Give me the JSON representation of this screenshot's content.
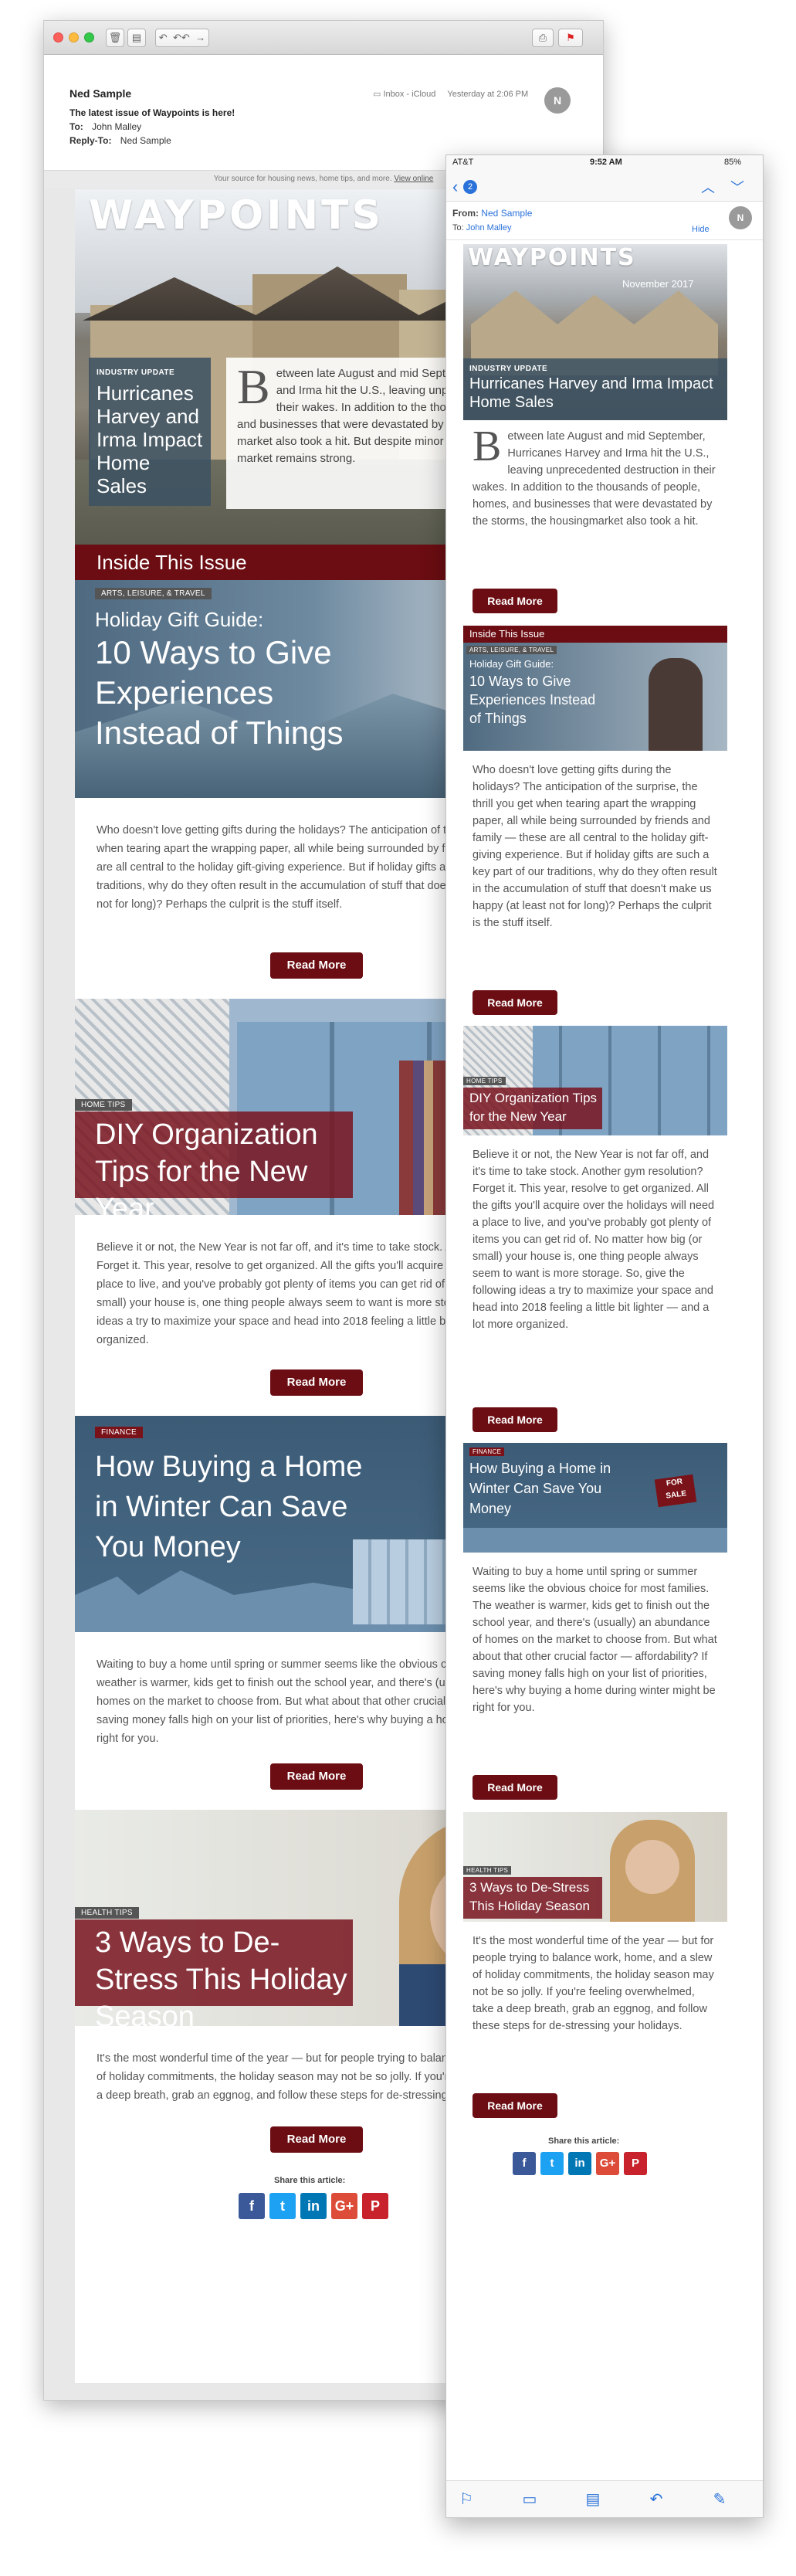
{
  "desktop": {
    "toolbar": {
      "buttons": [
        "trash-icon",
        "archive-icon",
        "reply-icon",
        "reply-all-icon",
        "forward-icon",
        "print-icon",
        "flag-icon"
      ]
    },
    "header": {
      "from_name": "Ned Sample",
      "subject": "The latest issue of Waypoints is here!",
      "to_label": "To:",
      "to_value": "John Malley",
      "reply_label": "Reply-To:",
      "reply_value": "Ned Sample",
      "mailbox": "Inbox - iCloud",
      "date": "Yesterday at 2:06 PM",
      "avatar": "N"
    },
    "top_note": "Your source for housing news, home tips, and more.",
    "top_note_link": "View online"
  },
  "newsletter": {
    "logo": "WAYPOINTS",
    "issue_date": "November 2017",
    "hero": {
      "tag": "INDUSTRY UPDATE",
      "title_desktop": "Hurricanes Harvey and Irma Impact Home Sales",
      "title_mobile": "Hurricanes Harvey and Irma Impact Home Sales",
      "dropcap": "B",
      "text_desktop": "etween late August and mid September, Hurricanes Harvey and Irma hit the U.S., leaving unprecedented destruction in their wakes. In addition to the thousands of people, homes, and businesses that were devastated by the storms, the housing market also took a hit. But despite minor setbacks, the housing market remains strong.",
      "text_mobile": "etween late August and mid September, Hurricanes Harvey and Irma hit the U.S., leaving unprecedented destruction in their wakes. In addition to the thousands of people, homes, and businesses that were devastated by the storms, the housingmarket also took a hit.",
      "button": "Read More"
    },
    "inside_label": "Inside This Issue",
    "articles": [
      {
        "tag": "ARTS, LEISURE, & TRAVEL",
        "kicker": "Holiday Gift Guide:",
        "title": "10 Ways to Give Experiences Instead of Things",
        "text": "Who doesn't love getting gifts during the holidays? The anticipation of the surprise, the thrill you get when tearing apart the wrapping paper, all while being surrounded by friends and family — these are all central to the holiday gift-giving experience. But if holiday gifts are such a key part of our traditions, why do they often result in the accumulation of stuff that doesn't make us happy (at least not for long)? Perhaps the culprit is the stuff itself.",
        "button": "Read More"
      },
      {
        "tag": "HOME TIPS",
        "title": "DIY Organization Tips for the New Year",
        "text": "Believe it or not, the New Year is not far off, and it's time to take stock. Another gym resolution? Forget it. This year, resolve to get organized. All the gifts you'll acquire over the holidays will need a place to live, and you've probably got plenty of items you can get rid of. No matter how big (or small) your house is, one thing people always seem to want is more storage. So, give the following ideas a try to maximize your space and head into 2018 feeling a little bit lighter — and a lot more organized.",
        "button": "Read More"
      },
      {
        "tag": "Finance",
        "title": "How Buying a Home in Winter Can Save You Money",
        "sign": "FOR SALE",
        "text": "Waiting to buy a home until spring or summer seems like the obvious choice for most families. The weather is warmer, kids get to finish out the school year, and there's (usually) an abundance of homes on the market to choose from. But what about that other crucial factor — affordability? If saving money falls high on your list of priorities, here's why buying a home during winter might be right for you.",
        "button": "Read More"
      },
      {
        "tag": "HEALTH TIPS",
        "title": "3 Ways to De-Stress This Holiday Season",
        "text": "It's the most wonderful time of the year — but for people trying to balance work, home, and a slew of holiday commitments, the holiday season may not be so jolly. If you're feeling overwhelmed, take a deep breath, grab an eggnog, and follow these steps for de-stressing your holidays.",
        "button": "Read More"
      }
    ],
    "share_label": "Share this article:",
    "share": [
      {
        "name": "facebook-icon",
        "glyph": "f",
        "color": "#3b5998"
      },
      {
        "name": "twitter-icon",
        "glyph": "t",
        "color": "#1da1f2"
      },
      {
        "name": "linkedin-icon",
        "glyph": "in",
        "color": "#0077b5"
      },
      {
        "name": "google-plus-icon",
        "glyph": "G+",
        "color": "#dd4b39"
      },
      {
        "name": "pinterest-icon",
        "glyph": "P",
        "color": "#c8232c"
      }
    ]
  },
  "phone": {
    "status": {
      "carrier": "AT&T",
      "time": "9:52 AM",
      "battery": "85%"
    },
    "nav": {
      "back_count": "2"
    },
    "from_label": "From:",
    "from_value": "Ned Sample",
    "to_label": "To:",
    "to_value": "John Malley",
    "hide": "Hide",
    "avatar": "N"
  },
  "colors": {
    "accent": "#6b0d12",
    "card": "#3c5262",
    "link": "#2a72d9"
  }
}
